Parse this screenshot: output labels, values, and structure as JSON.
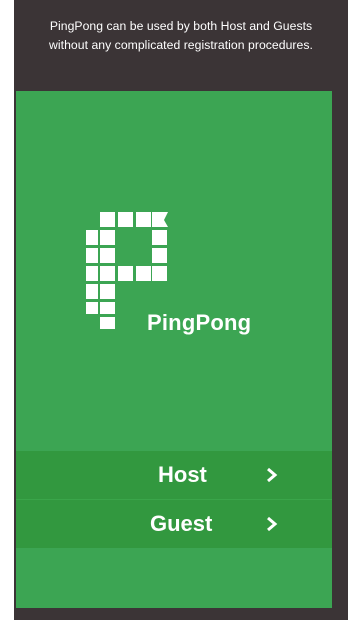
{
  "caption": {
    "line1": "PingPong can be used by both Host and Guests",
    "line2": "without any complicated registration procedures."
  },
  "app": {
    "name": "PingPong"
  },
  "actions": {
    "host_label": "Host",
    "guest_label": "Guest"
  },
  "colors": {
    "frame": "#3b3436",
    "screen_green": "#3ca553",
    "button_green": "#32983f"
  }
}
